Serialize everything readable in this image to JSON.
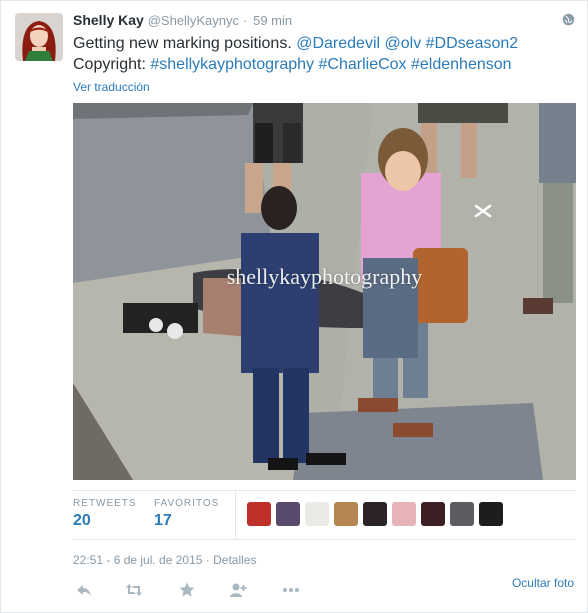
{
  "tweet": {
    "fullname": "Shelly Kay",
    "username": "@ShellyKaynyc",
    "separator": "·",
    "time": "59 min",
    "text_prefix": "Getting new marking positions. ",
    "mentions": [
      "@Daredevil",
      "@olv"
    ],
    "hashtag_line1": "#DDseason2",
    "copyright_label": "Copyright: ",
    "hashtags_line2": [
      "#shellykayphotography",
      "#CharlieCox",
      "#eldenhenson"
    ],
    "translate_link": "Ver traducción"
  },
  "photo": {
    "watermark": "shellykayphotography"
  },
  "stats": {
    "retweets_label": "RETWEETS",
    "retweets_value": "20",
    "favorites_label": "FAVORITOS",
    "favorites_value": "17",
    "faces_count": 9
  },
  "meta": {
    "timestamp": "22:51 - 6 de jul. de 2015",
    "separator": "·",
    "details": "Detalles",
    "flag_photo": "Ocultar foto"
  },
  "colors": {
    "link": "#2b7bb9",
    "muted": "#8899a6",
    "text": "#292f33"
  },
  "icons": [
    "globe-icon",
    "reply-icon",
    "retweet-icon",
    "favorite-icon",
    "follow-icon",
    "more-icon",
    "close-icon"
  ]
}
